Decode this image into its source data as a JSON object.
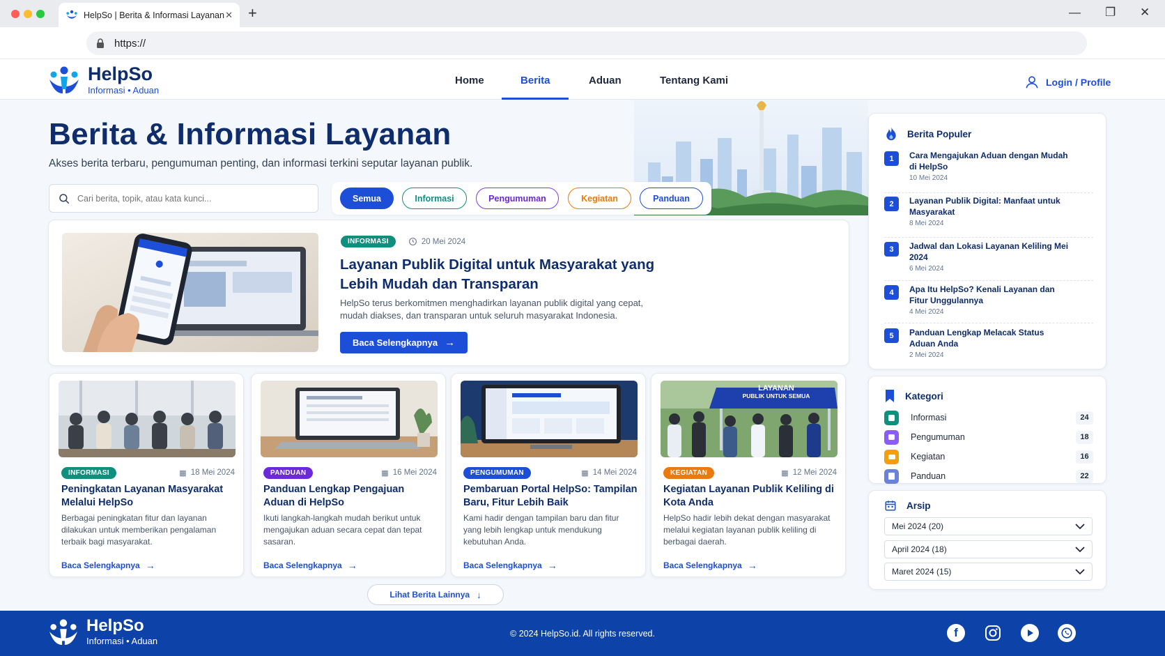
{
  "browser": {
    "tab_title": "HelpSo | Berita & Informasi Layanan",
    "url": "https://"
  },
  "brand": {
    "name": "HelpSo",
    "tagline": "Informasi • Aduan"
  },
  "nav": {
    "items": [
      "Home",
      "Berita",
      "Aduan",
      "Tentang Kami"
    ],
    "active": "Berita",
    "login": "Login / Profile"
  },
  "hero": {
    "title": "Berita & Informasi Layanan",
    "subtitle": "Akses berita terbaru, pengumuman penting, dan informasi terkini seputar layanan publik."
  },
  "search": {
    "placeholder": "Cari berita, topik, atau kata kunci..."
  },
  "filters": [
    {
      "label": "Semua",
      "active": true,
      "color": "#1d4ed8"
    },
    {
      "label": "Informasi",
      "color": "#0f8f7e"
    },
    {
      "label": "Pengumuman",
      "color": "#7c3aed"
    },
    {
      "label": "Kegiatan",
      "color": "#ea7a0e"
    },
    {
      "label": "Panduan",
      "color": "#1d4ed8"
    }
  ],
  "featured": {
    "badge": "INFORMASI",
    "date": "20 Mei 2024",
    "title": "Layanan Publik Digital untuk Masyarakat yang Lebih Mudah dan Transparan",
    "description": "HelpSo terus berkomitmen menghadirkan layanan publik digital yang cepat, mudah diakses, dan transparan untuk seluruh masyarakat Indonesia.",
    "button": "Baca Selengkapnya"
  },
  "news": [
    {
      "badge": "INFORMASI",
      "badge_color": "#0f8f7e",
      "date": "18 Mei 2024",
      "title": "Peningkatan Layanan Masyarakat Melalui HelpSo",
      "description": "Berbagai peningkatan fitur dan layanan dilakukan untuk memberikan pengalaman terbaik bagi masyarakat.",
      "link": "Baca Selengkapnya"
    },
    {
      "badge": "PANDUAN",
      "badge_color": "#6d28d9",
      "date": "16 Mei 2024",
      "title": "Panduan Lengkap Pengajuan Aduan di HelpSo",
      "description": "Ikuti langkah-langkah mudah berikut untuk mengajukan aduan secara cepat dan tepat sasaran.",
      "link": "Baca Selengkapnya"
    },
    {
      "badge": "PENGUMUMAN",
      "badge_color": "#1d4ed8",
      "date": "14 Mei 2024",
      "title": "Pembaruan Portal HelpSo: Tampilan Baru, Fitur Lebih Baik",
      "description": "Kami hadir dengan tampilan baru dan fitur yang lebih lengkap untuk mendukung kebutuhan Anda.",
      "link": "Baca Selengkapnya"
    },
    {
      "badge": "KEGIATAN",
      "badge_color": "#ea7a0e",
      "date": "12 Mei 2024",
      "title": "Kegiatan Layanan Publik Keliling di Kota Anda",
      "description": "HelpSo hadir lebih dekat dengan masyarakat melalui kegiatan layanan publik keliling di berbagai daerah.",
      "link": "Baca Selengkapnya"
    }
  ],
  "tent_banner": {
    "line1": "LAYANAN",
    "line2": "PUBLIK UNTUK SEMUA"
  },
  "load_more": "Lihat Berita Lainnya",
  "popular": {
    "title": "Berita Populer",
    "items": [
      {
        "num": "1",
        "title": "Cara Mengajukan Aduan dengan Mudah di HelpSo",
        "date": "10 Mei 2024"
      },
      {
        "num": "2",
        "title": "Layanan Publik Digital: Manfaat untuk Masyarakat",
        "date": "8 Mei 2024"
      },
      {
        "num": "3",
        "title": "Jadwal dan Lokasi Layanan Keliling Mei 2024",
        "date": "6 Mei 2024"
      },
      {
        "num": "4",
        "title": "Apa Itu HelpSo? Kenali Layanan dan Fitur Unggulannya",
        "date": "4 Mei 2024"
      },
      {
        "num": "5",
        "title": "Panduan Lengkap Melacak Status Aduan Anda",
        "date": "2 Mei 2024"
      }
    ]
  },
  "categories": {
    "title": "Kategori",
    "items": [
      {
        "label": "Informasi",
        "count": "24",
        "color": "#0f8f7e"
      },
      {
        "label": "Pengumuman",
        "count": "18",
        "color": "#7c3aed"
      },
      {
        "label": "Kegiatan",
        "count": "16",
        "color": "#ea7a0e"
      },
      {
        "label": "Panduan",
        "count": "22",
        "color": "#5b6fd6"
      }
    ]
  },
  "archive": {
    "title": "Arsip",
    "options": [
      "Mei 2024 (20)",
      "April 2024 (18)",
      "Maret 2024 (15)"
    ]
  },
  "footer": {
    "copyright": "© 2024 HelpSo.id. All rights reserved."
  }
}
